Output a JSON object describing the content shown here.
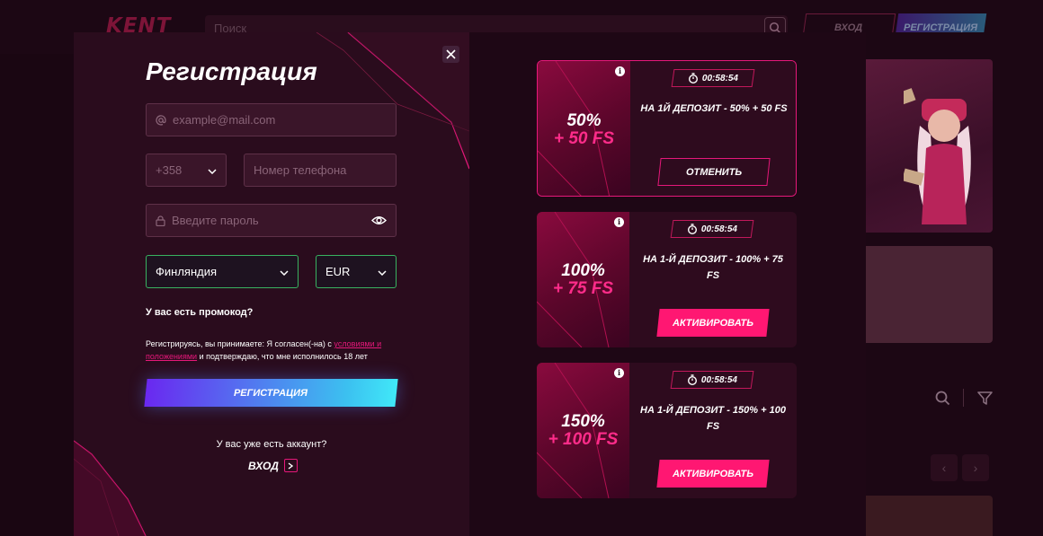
{
  "background": {
    "logo": "KENT",
    "search_placeholder": "Поиск",
    "login_label": "ВХОД",
    "register_label": "РЕГИСТРАЦИЯ"
  },
  "form": {
    "title": "Регистрация",
    "email_placeholder": "example@mail.com",
    "phone_code": "+358",
    "phone_placeholder": "Номер телефона",
    "password_placeholder": "Введите пароль",
    "country": "Финляндия",
    "currency": "EUR",
    "promo_label": "У вас есть промокод?",
    "terms_prefix": "Регистрируясь, вы принимаете: Я согласен(-на) с ",
    "terms_link": "условиями и положениями",
    "terms_suffix": " и подтверждаю, что мне исполнилось 18 лет",
    "submit_label": "РЕГИСТРАЦИЯ",
    "has_account": "У вас уже есть аккаунт?",
    "login_label": "ВХОД"
  },
  "bonuses": [
    {
      "percent": "50%",
      "fs": "+ 50 FS",
      "timer": "00:58:54",
      "title": "НА 1Й ДЕПОЗИТ - 50% + 50 FS",
      "button": "ОТМЕНИТЬ",
      "active": true
    },
    {
      "percent": "100%",
      "fs": "+ 75 FS",
      "timer": "00:58:54",
      "title": "НА 1-Й ДЕПОЗИТ - 100% + 75 FS",
      "button": "АКТИВИРОВАТЬ",
      "active": false
    },
    {
      "percent": "150%",
      "fs": "+ 100 FS",
      "timer": "00:58:54",
      "title": "НА 1-Й ДЕПОЗИТ - 150% + 100 FS",
      "button": "АКТИВИРОВАТЬ",
      "active": false
    }
  ],
  "colors": {
    "accent": "#e6187a",
    "valid": "#38b260",
    "panel": "#2a0c1d"
  },
  "icons": [
    "close-icon",
    "at-icon",
    "lock-icon",
    "eye-icon",
    "chevron-down-icon",
    "chevron-right-icon",
    "stopwatch-icon",
    "info-icon",
    "search-icon",
    "filter-icon"
  ]
}
